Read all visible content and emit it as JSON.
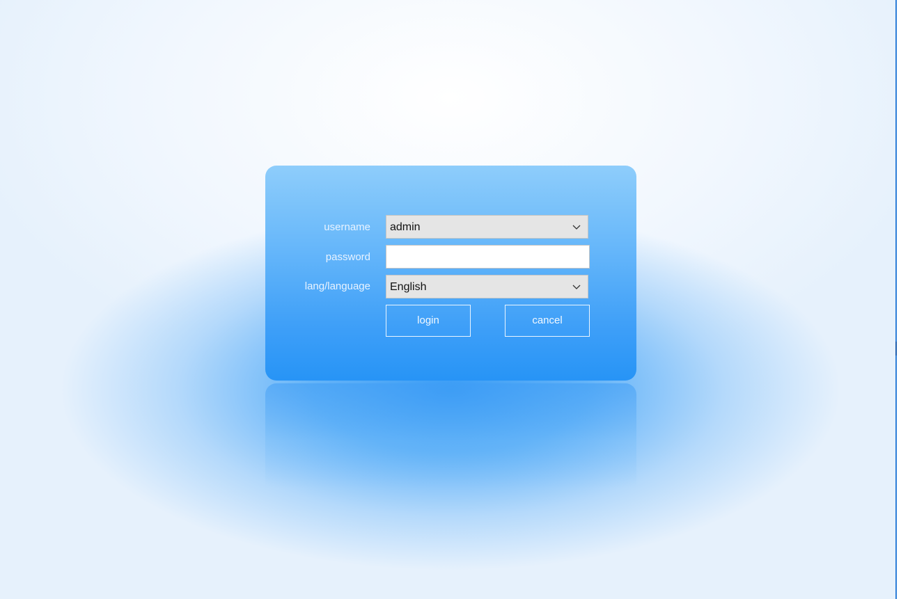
{
  "login_form": {
    "username_label": "username",
    "username_value": "admin",
    "password_label": "password",
    "password_value": "",
    "language_label": "lang/language",
    "language_value": "English",
    "login_button": "login",
    "cancel_button": "cancel"
  },
  "icons": {
    "dropdown": "chevron-down-icon"
  },
  "colors": {
    "panel_top": "#8ecdfb",
    "panel_bottom": "#2794f6",
    "label_text": "#e8f3ff",
    "button_border": "#eaf5ff",
    "background": "#e4f0fc"
  }
}
